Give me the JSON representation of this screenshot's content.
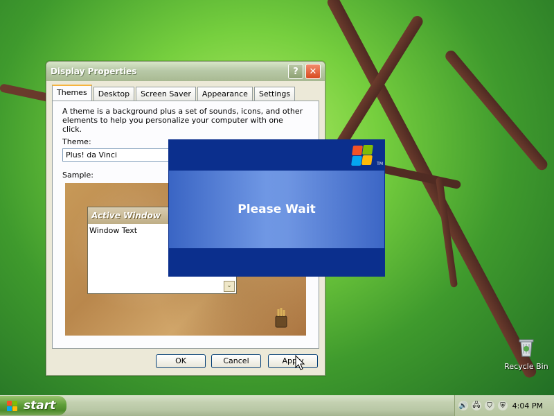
{
  "window": {
    "title": "Display Properties",
    "tabs": [
      "Themes",
      "Desktop",
      "Screen Saver",
      "Appearance",
      "Settings"
    ],
    "description": "A theme is a background plus a set of sounds, icons, and other elements to help you personalize your computer with one click.",
    "theme_label": "Theme:",
    "theme_value": "Plus! da Vinci",
    "sample_label": "Sample:",
    "sample": {
      "title": "Active Window",
      "text": "Window Text"
    },
    "buttons": {
      "ok": "OK",
      "cancel": "Cancel",
      "apply": "Apply"
    }
  },
  "overlay": {
    "message": "Please Wait",
    "tm": "TM"
  },
  "desktop": {
    "recycle_bin": "Recycle Bin"
  },
  "taskbar": {
    "start": "start",
    "clock": "4:04 PM"
  }
}
